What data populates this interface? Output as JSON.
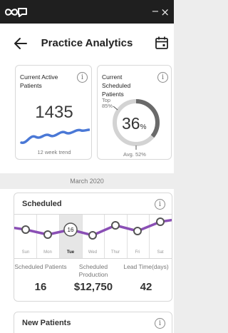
{
  "window": {
    "minimize": "−",
    "close": "×"
  },
  "header": {
    "title": "Practice Analytics"
  },
  "active_patients": {
    "title": "Current Active Patients",
    "value": "1435",
    "trend_label": "12 week trend"
  },
  "scheduled_patients": {
    "title": "Current Scheduled Patients",
    "top_label": "Top",
    "top_percent": "85%",
    "value": "36",
    "unit": "%",
    "avg_label": "Avg. 52%",
    "gauge_fraction": 0.36
  },
  "date_label": "March 2020",
  "scheduled": {
    "title": "Scheduled",
    "days": [
      "Sun",
      "Mon",
      "Tue",
      "Wed",
      "Thur",
      "Fri",
      "Sat"
    ],
    "selected_day": "Tue",
    "selected_value": "16",
    "metrics": [
      {
        "label": "Scheduled Patients",
        "value": "16"
      },
      {
        "label": "Scheduled Production",
        "value": "$12,750"
      },
      {
        "label": "Lead Time(days)",
        "value": "42"
      }
    ]
  },
  "new_patients": {
    "title": "New Patients"
  },
  "colors": {
    "accent_line": "#8a4fb5",
    "trend_blue": "#4a78d6",
    "gauge_dark": "#6a6a6a",
    "gauge_light": "#d3d3d3"
  }
}
